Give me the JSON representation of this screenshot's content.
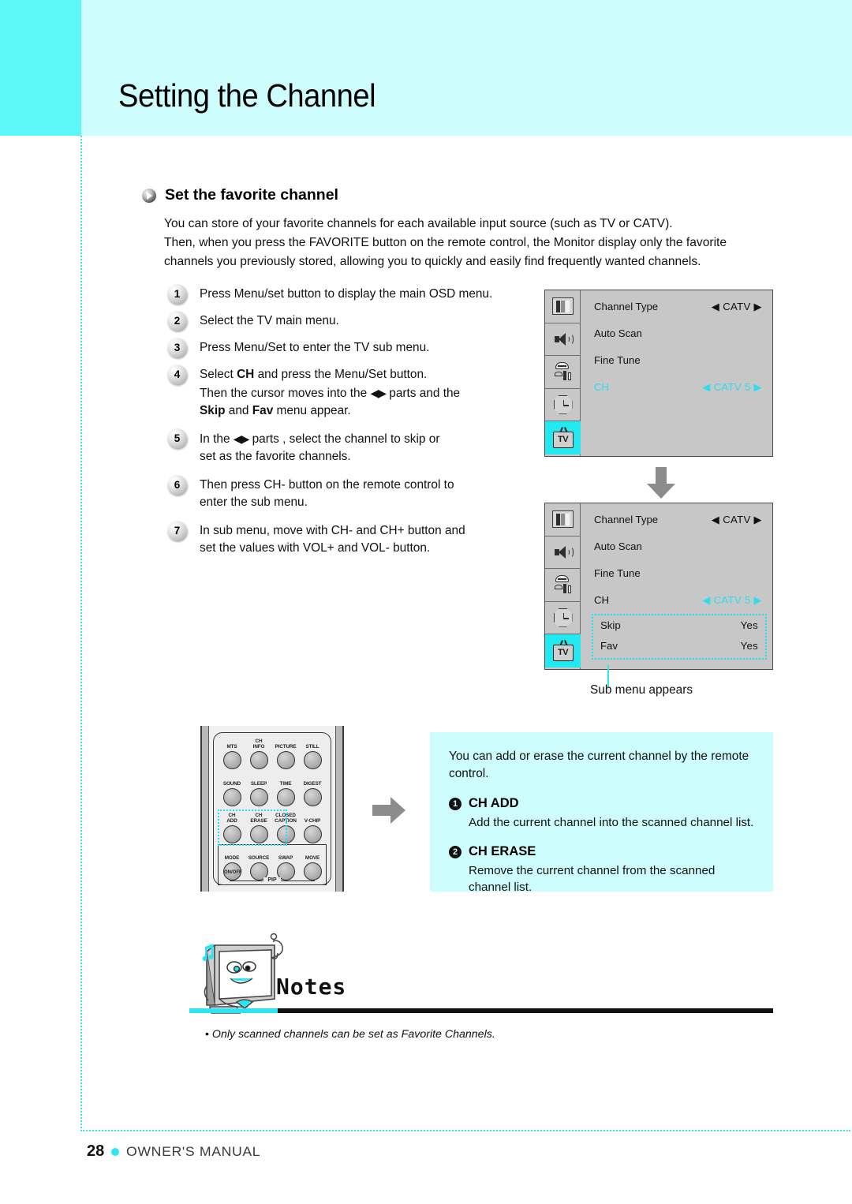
{
  "header": {
    "title": "Setting the Channel",
    "band_color": "#cdfdfd",
    "accent_color": "#5cf7f7"
  },
  "section": {
    "heading": "Set the favorite channel",
    "intro_lines": [
      "You can store of your favorite channels for each available input source (such as TV or CATV).",
      "Then, when you press the FAVORITE button on the remote control, the Monitor display only the favorite",
      "channels you previously stored, allowing you to quickly and easily find frequently wanted channels."
    ]
  },
  "steps": [
    {
      "num": "1",
      "lines": [
        "Press Menu/set button to display the main OSD menu."
      ]
    },
    {
      "num": "2",
      "lines": [
        "Select the TV main menu."
      ]
    },
    {
      "num": "3",
      "lines": [
        "Press Menu/Set to enter the TV sub menu."
      ]
    },
    {
      "num": "4",
      "lines": [
        "Select CH and press the Menu/Set button.",
        "Then the cursor moves into the ◀▶ parts and the",
        "Skip and Fav menu appear."
      ]
    },
    {
      "num": "5",
      "lines": [
        "In the ◀▶ parts , select the channel to skip or",
        "set as the favorite channels."
      ]
    },
    {
      "num": "6",
      "lines": [
        "Then press CH- button on the remote control to",
        "enter the sub menu."
      ]
    },
    {
      "num": "7",
      "lines": [
        "In sub menu, move with CH- and CH+ button and",
        "set the values with VOL+ and VOL- button."
      ]
    }
  ],
  "osd": {
    "icons": [
      "picture-icon",
      "sound-icon",
      "setup-icon",
      "clock-icon",
      "tv-icon"
    ],
    "tv_icon_label": "TV",
    "selected_icon": "tv-icon",
    "highlight_color": "#22e8f0",
    "panel1": {
      "rows": [
        {
          "label": "Channel Type",
          "value": "◀ CATV ▶",
          "highlight": false
        },
        {
          "label": "Auto Scan",
          "value": "",
          "highlight": false
        },
        {
          "label": "Fine Tune",
          "value": "",
          "highlight": false
        },
        {
          "label": "CH",
          "value": "◀ CATV 5 ▶",
          "highlight": true
        }
      ]
    },
    "panel2": {
      "rows": [
        {
          "label": "Channel Type",
          "value": "◀ CATV ▶",
          "highlight": false
        },
        {
          "label": "Auto Scan",
          "value": "",
          "highlight": false
        },
        {
          "label": "Fine Tune",
          "value": "",
          "highlight": false
        },
        {
          "label": "CH",
          "value": "◀ CATV 5 ▶",
          "highlight": true
        }
      ],
      "submenu": [
        {
          "label": "Skip",
          "value": "Yes"
        },
        {
          "label": "Fav",
          "value": "Yes"
        }
      ]
    },
    "sub_caption": "Sub menu appears"
  },
  "remote": {
    "buttons": [
      {
        "cap": "MTS",
        "cap2": ""
      },
      {
        "cap": "CH",
        "cap2": "INFO"
      },
      {
        "cap": "PICTURE",
        "cap2": ""
      },
      {
        "cap": "STILL",
        "cap2": ""
      },
      {
        "cap": "SOUND",
        "cap2": ""
      },
      {
        "cap": "SLEEP",
        "cap2": ""
      },
      {
        "cap": "TIME",
        "cap2": ""
      },
      {
        "cap": "DIGEST",
        "cap2": ""
      },
      {
        "cap": "CH",
        "cap2": "ADD"
      },
      {
        "cap": "CH",
        "cap2": "ERASE"
      },
      {
        "cap": "CLOSED",
        "cap2": "CAPTION"
      },
      {
        "cap": "V-CHIP",
        "cap2": ""
      },
      {
        "cap": "MODE",
        "cap2": ""
      },
      {
        "cap": "SOURCE",
        "cap2": ""
      },
      {
        "cap": "SWAP",
        "cap2": ""
      },
      {
        "cap": "MOVE",
        "cap2": ""
      }
    ],
    "pip_label": "PIP",
    "onoff_label": "ON/OFF"
  },
  "info_box": {
    "lead": "You can add or erase the current channel by the remote control.",
    "items": [
      {
        "num": "1",
        "title": "CH ADD",
        "desc": "Add the current channel into the scanned channel list."
      },
      {
        "num": "2",
        "title": "CH ERASE",
        "desc": "Remove the current channel from the scanned channel list."
      }
    ]
  },
  "notes": {
    "title": "Notes",
    "bullet": "•",
    "text": "Only scanned channels can be set as Favorite Channels."
  },
  "footer": {
    "page": "28",
    "label": "OWNER'S MANUAL"
  }
}
